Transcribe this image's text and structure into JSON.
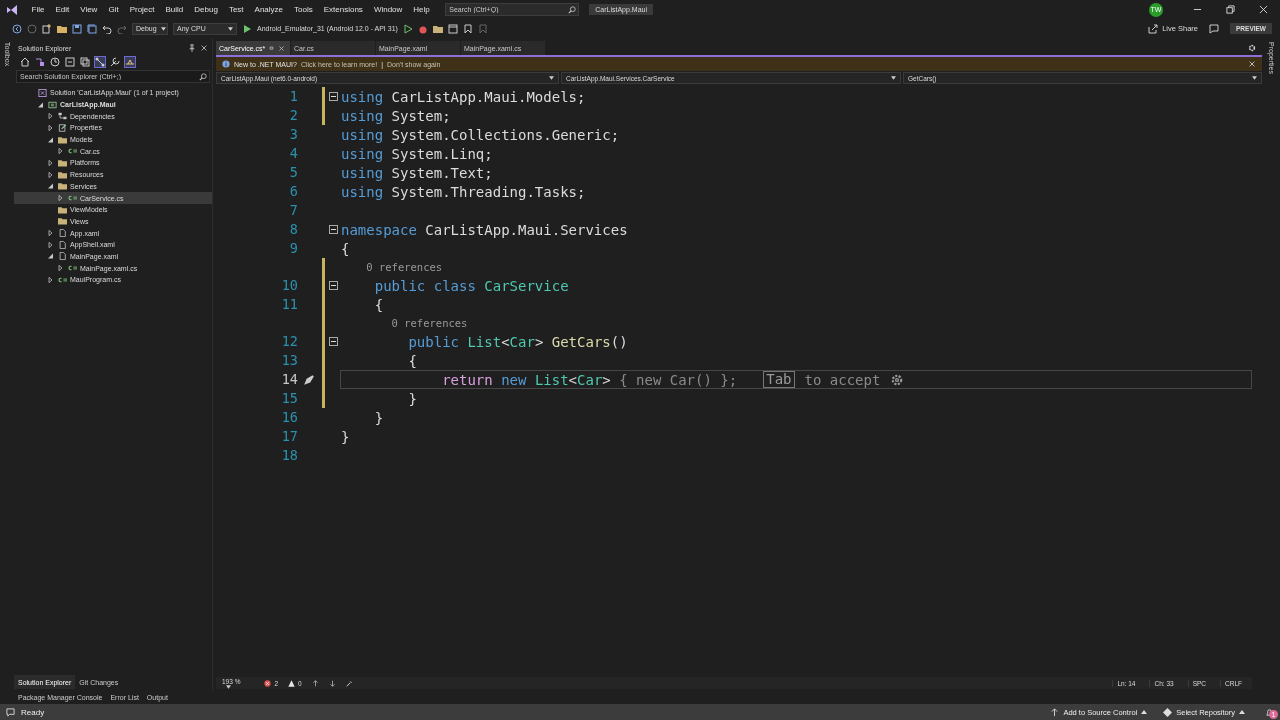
{
  "menu_bar": {
    "items": [
      "File",
      "Edit",
      "View",
      "Git",
      "Project",
      "Build",
      "Debug",
      "Test",
      "Analyze",
      "Tools",
      "Extensions",
      "Window",
      "Help"
    ],
    "search": {
      "placeholder": "Search (Ctrl+Q)"
    },
    "solution_name": "CarListApp.Maui",
    "avatar": "TW"
  },
  "toolbar": {
    "configuration": "Debug",
    "platform": "Any CPU",
    "target": "Android_Emulator_31 (Android 12.0 - API 31)",
    "live_share": "Live Share",
    "preview": "PREVIEW"
  },
  "toolbox_label": "Toolbox",
  "properties_label": "Properties",
  "solution_explorer": {
    "title": "Solution Explorer",
    "search": {
      "placeholder": "Search Solution Explorer (Ctrl+;)"
    },
    "tree": [
      {
        "label": "Solution 'CarListApp.Maui' (1 of 1 project)",
        "kind": "solution",
        "selected": false,
        "children": [
          {
            "label": "CarListApp.Maui",
            "kind": "project",
            "expanded": true,
            "selected": false,
            "children": [
              {
                "label": "Dependencies",
                "kind": "dependencies",
                "expanded": false,
                "selected": false
              },
              {
                "label": "Properties",
                "kind": "properties",
                "expanded": false,
                "selected": false
              },
              {
                "label": "Models",
                "kind": "folder",
                "expanded": true,
                "selected": false,
                "children": [
                  {
                    "label": "Car.cs",
                    "kind": "csharp",
                    "expanded": false,
                    "selected": false
                  }
                ]
              },
              {
                "label": "Platforms",
                "kind": "folder",
                "expanded": false,
                "selected": false
              },
              {
                "label": "Resources",
                "kind": "folder",
                "expanded": false,
                "selected": false
              },
              {
                "label": "Services",
                "kind": "folder",
                "expanded": true,
                "selected": false,
                "children": [
                  {
                    "label": "CarService.cs",
                    "kind": "csharp",
                    "expanded": false,
                    "selected": true
                  }
                ]
              },
              {
                "label": "ViewModels",
                "kind": "folder",
                "selected": false
              },
              {
                "label": "Views",
                "kind": "folder",
                "selected": false
              },
              {
                "label": "App.xaml",
                "kind": "xaml",
                "expanded": false,
                "selected": false
              },
              {
                "label": "AppShell.xaml",
                "kind": "xaml",
                "expanded": false,
                "selected": false
              },
              {
                "label": "MainPage.xaml",
                "kind": "xaml",
                "expanded": true,
                "selected": false,
                "children": [
                  {
                    "label": "MainPage.xaml.cs",
                    "kind": "csharp",
                    "expanded": false,
                    "selected": false
                  }
                ]
              },
              {
                "label": "MauiProgram.cs",
                "kind": "csharp",
                "expanded": false,
                "selected": false
              }
            ]
          }
        ]
      }
    ]
  },
  "panel_tabs": [
    {
      "label": "Solution Explorer",
      "selected": true
    },
    {
      "label": "Git Changes",
      "selected": false
    }
  ],
  "tool_windows": [
    "Package Manager Console",
    "Error List",
    "Output"
  ],
  "editor": {
    "tabs": [
      {
        "label": "CarService.cs*",
        "selected": true
      },
      {
        "label": "Car.cs",
        "selected": false
      },
      {
        "label": "MainPage.xaml",
        "selected": false
      },
      {
        "label": "MainPage.xaml.cs",
        "selected": false
      }
    ],
    "infobar": {
      "message": "New to .NET MAUI?",
      "link": "Click here to learn more!",
      "separator": "|",
      "dismiss": "Don't show again"
    },
    "nav": {
      "project": "CarListApp.Maui (net6.0-android)",
      "class": "CarListApp.Maui.Services.CarService",
      "member": "GetCars()"
    },
    "lines": [
      {
        "kind": "code",
        "number": "1",
        "fold": true,
        "modified": true,
        "tokens": [
          {
            "text": "using ",
            "kind": "kw"
          },
          {
            "text": "CarListApp.Maui.Models;",
            "kind": "plain"
          }
        ]
      },
      {
        "kind": "code",
        "number": "2",
        "fold": false,
        "modified": true,
        "tokens": [
          {
            "text": "using ",
            "kind": "kw"
          },
          {
            "text": "System;",
            "kind": "plain"
          }
        ]
      },
      {
        "kind": "code",
        "number": "3",
        "fold": false,
        "modified": false,
        "tokens": [
          {
            "text": "using ",
            "kind": "kw"
          },
          {
            "text": "System.Collections.Generic;",
            "kind": "plain"
          }
        ]
      },
      {
        "kind": "code",
        "number": "4",
        "fold": false,
        "modified": false,
        "tokens": [
          {
            "text": "using ",
            "kind": "kw"
          },
          {
            "text": "System.Linq;",
            "kind": "plain"
          }
        ]
      },
      {
        "kind": "code",
        "number": "5",
        "fold": false,
        "modified": false,
        "tokens": [
          {
            "text": "using ",
            "kind": "kw"
          },
          {
            "text": "System.Text;",
            "kind": "plain"
          }
        ]
      },
      {
        "kind": "code",
        "number": "6",
        "fold": false,
        "modified": false,
        "tokens": [
          {
            "text": "using ",
            "kind": "kw"
          },
          {
            "text": "System.Threading.Tasks;",
            "kind": "plain"
          }
        ]
      },
      {
        "kind": "code",
        "number": "7",
        "fold": false,
        "modified": false
      },
      {
        "kind": "code",
        "number": "8",
        "fold": true,
        "modified": false,
        "tokens": [
          {
            "text": "namespace ",
            "kind": "kw"
          },
          {
            "text": "CarListApp.Maui.Services",
            "kind": "plain"
          }
        ]
      },
      {
        "kind": "code",
        "number": "9",
        "fold": false,
        "modified": false,
        "tokens": [
          {
            "text": "{",
            "kind": "plain"
          }
        ]
      },
      {
        "kind": "lens",
        "text": "    0 references"
      },
      {
        "kind": "code",
        "number": "10",
        "fold": true,
        "modified": true,
        "tokens": [
          {
            "text": "    public class ",
            "kind": "kw"
          },
          {
            "text": "CarService",
            "kind": "type"
          }
        ]
      },
      {
        "kind": "code",
        "number": "11",
        "fold": false,
        "modified": true,
        "tokens": [
          {
            "text": "    {",
            "kind": "plain"
          }
        ]
      },
      {
        "kind": "lens",
        "text": "        0 references"
      },
      {
        "kind": "code",
        "number": "12",
        "fold": true,
        "modified": true,
        "tokens": [
          {
            "text": "        public ",
            "kind": "kw"
          },
          {
            "text": "List",
            "kind": "type"
          },
          {
            "text": "<",
            "kind": "plain"
          },
          {
            "text": "Car",
            "kind": "type"
          },
          {
            "text": "> ",
            "kind": "plain"
          },
          {
            "text": "GetCars",
            "kind": "method"
          },
          {
            "text": "()",
            "kind": "plain"
          }
        ]
      },
      {
        "kind": "code",
        "number": "13",
        "fold": false,
        "modified": true,
        "tokens": [
          {
            "text": "        {",
            "kind": "plain"
          }
        ]
      },
      {
        "kind": "code",
        "number": "14",
        "fold": false,
        "modified": true,
        "current": true,
        "tokens": [
          {
            "text": "            return ",
            "kind": "ctl"
          },
          {
            "text": "new ",
            "kind": "kw"
          },
          {
            "text": "List",
            "kind": "type"
          },
          {
            "text": "<",
            "kind": "plain"
          },
          {
            "text": "Car",
            "kind": "type"
          },
          {
            "text": ">",
            "kind": "plain"
          }
        ],
        "suggestion": " { new Car() };"
      },
      {
        "kind": "code",
        "number": "15",
        "fold": false,
        "modified": true,
        "tokens": [
          {
            "text": "        }",
            "kind": "plain"
          }
        ]
      },
      {
        "kind": "code",
        "number": "16",
        "fold": false,
        "modified": false,
        "tokens": [
          {
            "text": "    }",
            "kind": "plain"
          }
        ]
      },
      {
        "kind": "code",
        "number": "17",
        "fold": false,
        "modified": false,
        "tokens": [
          {
            "text": "}",
            "kind": "plain"
          }
        ]
      },
      {
        "kind": "code",
        "number": "18",
        "fold": false,
        "modified": false
      }
    ],
    "hint": {
      "key": "Tab",
      "text": "to accept"
    },
    "zoom": "193 %",
    "errors": "2",
    "warnings": "0",
    "line": "Ln: 14",
    "column": "Ch: 33",
    "whitespace": "SPC",
    "line_ending": "CRLF"
  },
  "status_bar": {
    "text": "Ready",
    "source_control": "Add to Source Control",
    "repository": "Select Repository",
    "notifications": "1"
  }
}
